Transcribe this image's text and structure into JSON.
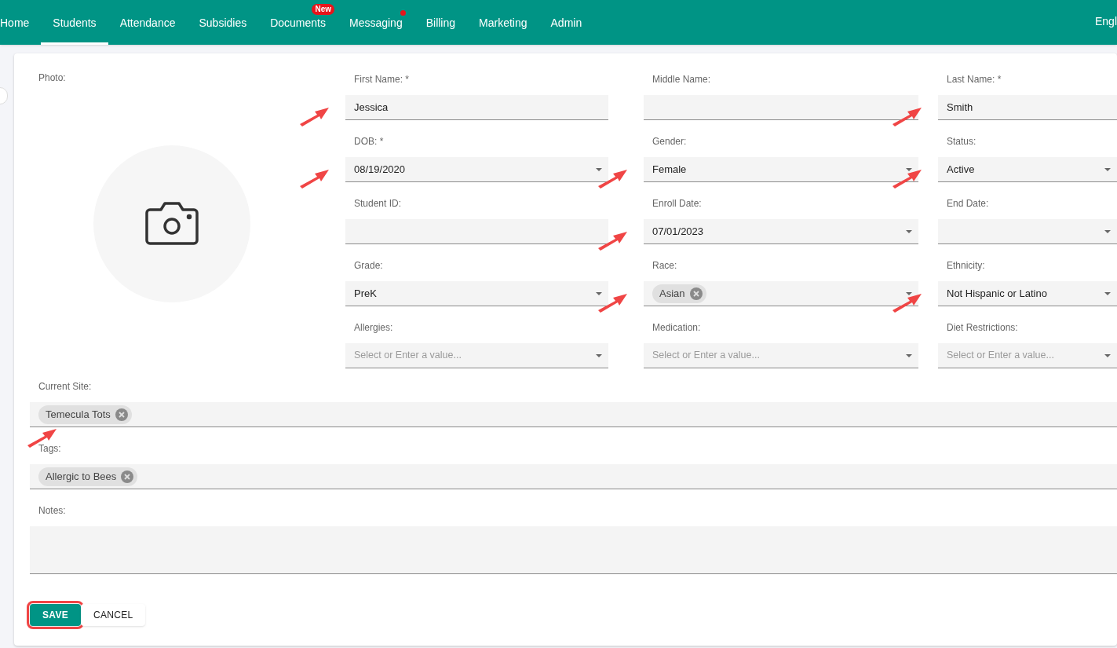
{
  "nav": {
    "items": [
      {
        "label": "Home",
        "selected": false
      },
      {
        "label": "Students",
        "selected": true
      },
      {
        "label": "Attendance",
        "selected": false
      },
      {
        "label": "Subsidies",
        "selected": false
      },
      {
        "label": "Documents",
        "selected": false,
        "badge": "New"
      },
      {
        "label": "Messaging",
        "selected": false,
        "dot": true
      },
      {
        "label": "Billing",
        "selected": false
      },
      {
        "label": "Marketing",
        "selected": false
      },
      {
        "label": "Admin",
        "selected": false
      }
    ],
    "language": "Engl"
  },
  "photo": {
    "label": "Photo:"
  },
  "fields": [
    {
      "label": "First Name: *",
      "kind": "text",
      "value": "Jessica",
      "arrow": true
    },
    {
      "label": "Middle Name:",
      "kind": "text",
      "arrow": false
    },
    {
      "label": "Last Name: *",
      "kind": "text",
      "value": "Smith",
      "arrow": true
    },
    {
      "label": "DOB: *",
      "kind": "select",
      "value": "08/19/2020",
      "arrow": true
    },
    {
      "label": "Gender:",
      "kind": "select",
      "value": "Female",
      "arrow": true
    },
    {
      "label": "Status:",
      "kind": "select",
      "value": "Active",
      "arrow": true
    },
    {
      "label": "Student ID:",
      "kind": "text",
      "arrow": false
    },
    {
      "label": "Enroll Date:",
      "kind": "select",
      "value": "07/01/2023",
      "arrow": true
    },
    {
      "label": "End Date:",
      "kind": "select",
      "arrow": false
    },
    {
      "label": "Grade:",
      "kind": "select",
      "value": "PreK",
      "arrow": false
    },
    {
      "label": "Race:",
      "kind": "chips",
      "chips": [
        "Asian"
      ],
      "arrow": true
    },
    {
      "label": "Ethnicity:",
      "kind": "select",
      "value": "Not Hispanic or Latino",
      "arrow": true
    },
    {
      "label": "Allergies:",
      "kind": "select",
      "placeholder": "Select or Enter a value...",
      "arrow": false
    },
    {
      "label": "Medication:",
      "kind": "select",
      "placeholder": "Select or Enter a value...",
      "arrow": false
    },
    {
      "label": "Diet Restrictions:",
      "kind": "select",
      "placeholder": "Select or Enter a value...",
      "arrow": false
    }
  ],
  "wide_fields": [
    {
      "label": "Current Site:",
      "kind": "chips",
      "chips": [
        "Temecula Tots"
      ],
      "arrow": true
    },
    {
      "label": "Tags:",
      "kind": "chips",
      "chips": [
        "Allergic to Bees"
      ],
      "arrow": false
    },
    {
      "label": "Notes:",
      "kind": "textarea",
      "arrow": false
    }
  ],
  "buttons": [
    {
      "label": "SAVE",
      "kind": "primary",
      "highlighted": true
    },
    {
      "label": "CANCEL",
      "kind": "secondary",
      "highlighted": false
    }
  ]
}
